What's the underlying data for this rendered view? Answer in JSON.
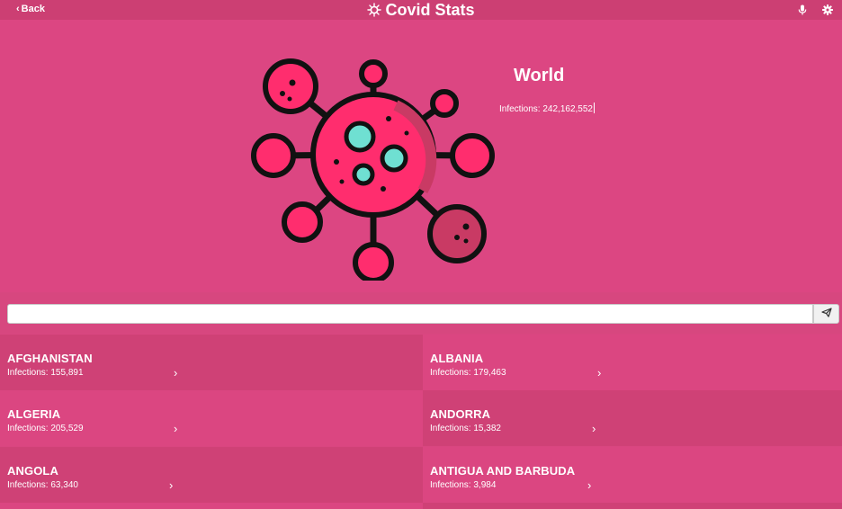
{
  "header": {
    "back_label": "Back",
    "title": "Covid Stats"
  },
  "world": {
    "name": "World",
    "infections_label": "Infections: 242,162,552"
  },
  "search": {
    "value": "",
    "placeholder": ""
  },
  "countries": [
    {
      "name": "AFGHANISTAN",
      "infections": "Infections: 155,891"
    },
    {
      "name": "ALBANIA",
      "infections": "Infections: 179,463"
    },
    {
      "name": "ALGERIA",
      "infections": "Infections: 205,529"
    },
    {
      "name": "ANDORRA",
      "infections": "Infections: 15,382"
    },
    {
      "name": "ANGOLA",
      "infections": "Infections: 63,340"
    },
    {
      "name": "ANTIGUA AND BARBUDA",
      "infections": "Infections: 3,984"
    }
  ],
  "colors": {
    "background": "#d94680",
    "topbar": "#cc3f73",
    "card_dark": "#cf4176",
    "card_light": "#db4681",
    "virus_body": "#ff2d6e",
    "virus_shadow": "#c93a64",
    "virus_spot": "#6fe0d2"
  },
  "icons": [
    "back-chevron-icon",
    "virus-logo-icon",
    "microphone-icon",
    "gear-icon",
    "send-icon",
    "chevron-right-icon"
  ]
}
